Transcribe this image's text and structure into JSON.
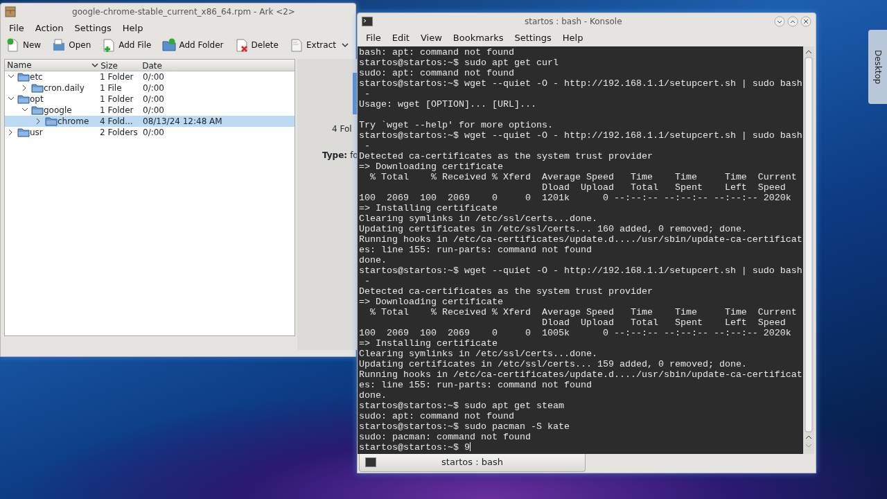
{
  "ark_window": {
    "title": "google-chrome-stable_current_x86_64.rpm - Ark <2>",
    "menu": [
      "File",
      "Action",
      "Settings",
      "Help"
    ],
    "toolbar": [
      {
        "label": "New",
        "kind": "new"
      },
      {
        "label": "Open",
        "kind": "open"
      },
      {
        "label": "Add File",
        "kind": "addfile"
      },
      {
        "label": "Add Folder",
        "kind": "addfolder"
      },
      {
        "label": "Delete",
        "kind": "delete"
      },
      {
        "label": "Extract",
        "kind": "extract"
      }
    ],
    "columns": [
      "Name",
      "Size",
      "Date"
    ],
    "tree": [
      {
        "name": "etc",
        "size": "1 Folder",
        "date": "0/:00",
        "expanded": true,
        "selected": false,
        "children": [
          {
            "name": "cron.daily",
            "size": "1 File",
            "date": "0/:00",
            "expanded": false,
            "selected": false
          }
        ]
      },
      {
        "name": "opt",
        "size": "1 Folder",
        "date": "0/:00",
        "expanded": true,
        "selected": false,
        "children": [
          {
            "name": "google",
            "size": "1 Folder",
            "date": "0/:00",
            "expanded": true,
            "selected": false,
            "children": [
              {
                "name": "chrome",
                "size": "4 Fold...",
                "date": "08/13/24 12:48 AM",
                "expanded": false,
                "selected": true
              }
            ]
          }
        ]
      },
      {
        "name": "usr",
        "size": "2 Folders",
        "date": "0/:00",
        "expanded": false,
        "selected": false
      }
    ],
    "info": {
      "count": "4 Fol",
      "type_label": "Type:",
      "type_value": "fo"
    }
  },
  "konsole_window": {
    "title": "startos : bash - Konsole",
    "menu": [
      "File",
      "Edit",
      "View",
      "Bookmarks",
      "Settings",
      "Help"
    ],
    "blocks": [
      [
        "bash: apt: command not found",
        "startos@startos:~$ sudo apt get curl",
        "sudo: apt: command not found",
        "startos@startos:~$ wget --quiet -O - http://192.168.1.1/setupcert.sh | sudo bash",
        " -",
        "Usage: wget [OPTION]... [URL]..."
      ],
      [
        "Try `wget --help' for more options.",
        "startos@startos:~$ wget --quiet -O - http://192.168.1.1/setupcert.sh | sudo bash",
        " -",
        "Detected ca-certificates as the system trust provider",
        "=> Downloading certificate",
        "  % Total    % Received % Xferd  Average Speed   Time    Time     Time  Current",
        "                                 Dload  Upload   Total   Spent    Left  Speed",
        "100  2069  100  2069    0     0  1201k      0 --:--:-- --:--:-- --:--:-- 2020k",
        "=> Installing certificate",
        "Clearing symlinks in /etc/ssl/certs...done.",
        "Updating certificates in /etc/ssl/certs... 160 added, 0 removed; done.",
        "Running hooks in /etc/ca-certificates/update.d..../usr/sbin/update-ca-certificat",
        "es: line 155: run-parts: command not found",
        "done.",
        "startos@startos:~$ wget --quiet -O - http://192.168.1.1/setupcert.sh | sudo bash",
        " -",
        "Detected ca-certificates as the system trust provider",
        "=> Downloading certificate",
        "  % Total    % Received % Xferd  Average Speed   Time    Time     Time  Current",
        "                                 Dload  Upload   Total   Spent    Left  Speed",
        "100  2069  100  2069    0     0  1005k      0 --:--:-- --:--:-- --:--:-- 2020k",
        "=> Installing certificate",
        "Clearing symlinks in /etc/ssl/certs...done.",
        "Updating certificates in /etc/ssl/certs... 159 added, 0 removed; done.",
        "Running hooks in /etc/ca-certificates/update.d..../usr/sbin/update-ca-certificat",
        "es: line 155: run-parts: command not found",
        "done.",
        "startos@startos:~$ sudo apt get steam",
        "sudo: apt: command not found",
        "startos@startos:~$ sudo pacman -S kate",
        "sudo: pacman: command not found",
        "startos@startos:~$ 9"
      ]
    ],
    "tabs": [
      {
        "label": "startos : bash",
        "selected": true
      }
    ]
  },
  "desktop_tab": "Desktop"
}
